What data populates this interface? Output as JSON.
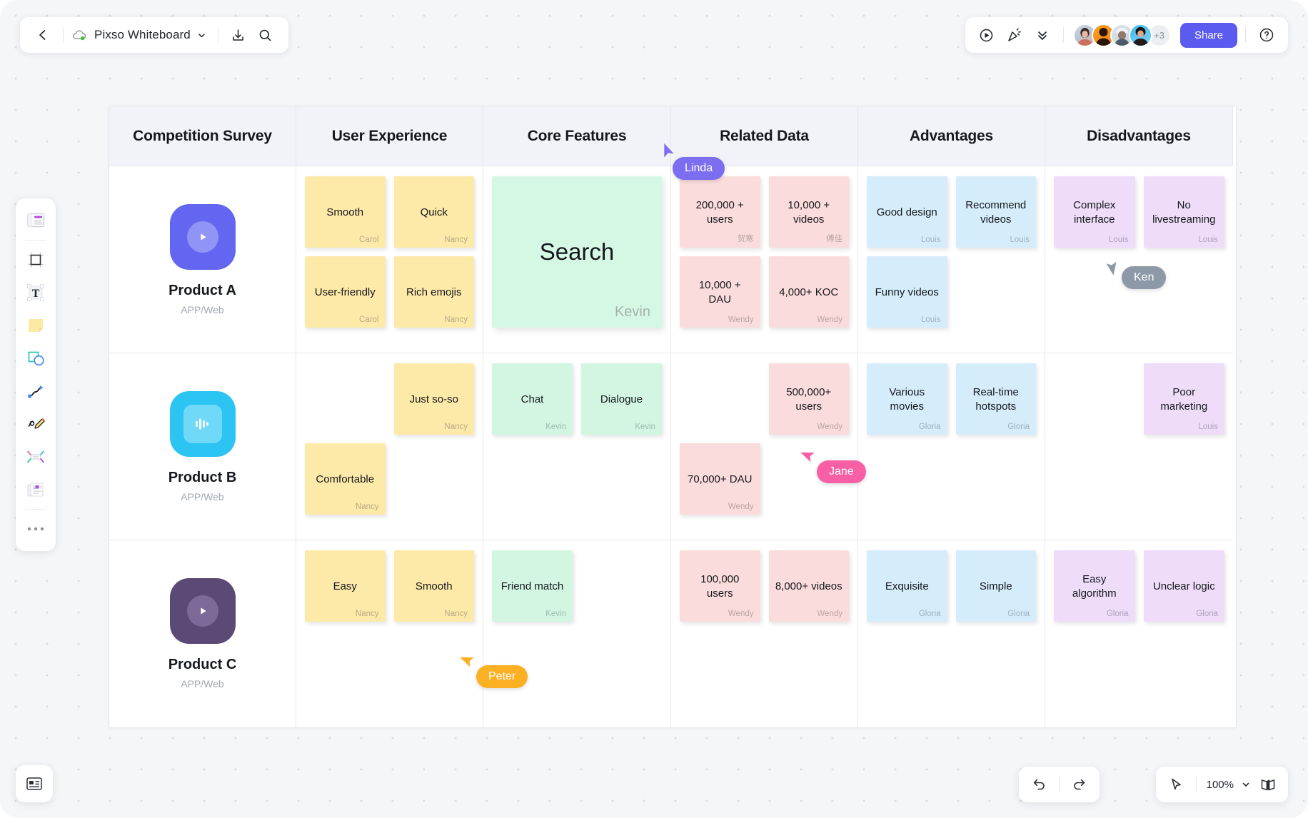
{
  "topbar": {
    "back_icon": "chevron-left-icon",
    "cloud_icon": "cloud-sync-icon",
    "title": "Pixso Whiteboard",
    "title_caret": "chevron-down-icon",
    "export_icon": "download-icon",
    "search_icon": "search-icon"
  },
  "topbar_right": {
    "present_icon": "play-circle-icon",
    "celebrate_icon": "party-popper-icon",
    "collapse_icon": "double-chevron-down-icon",
    "avatars": [
      "user-1",
      "user-2",
      "user-3",
      "user-4"
    ],
    "avatar_overflow": "+3",
    "share_label": "Share",
    "help_icon": "question-circle-icon"
  },
  "left_tools": [
    {
      "name": "frame-template-icon"
    },
    {
      "name": "crop-frame-icon"
    },
    {
      "name": "text-icon"
    },
    {
      "name": "sticky-note-icon"
    },
    {
      "name": "shapes-icon"
    },
    {
      "name": "connector-line-icon"
    },
    {
      "name": "pencil-draw-icon"
    },
    {
      "name": "mindmap-icon"
    },
    {
      "name": "cards-icon"
    },
    {
      "name": "more-options-icon"
    }
  ],
  "bottom_left": {
    "icon": "panel-toggle-icon"
  },
  "bottom_right": {
    "undo_icon": "undo-icon",
    "redo_icon": "redo-icon",
    "cursor_icon": "pointer-cursor-icon",
    "zoom_value": "100%",
    "zoom_caret": "chevron-down-icon",
    "minimap_icon": "minimap-book-icon"
  },
  "board": {
    "headers": [
      "Competition Survey",
      "User Experience",
      "Core Features",
      "Related Data",
      "Advantages",
      "Disadvantages"
    ],
    "rows": [
      {
        "product": {
          "name": "Product A",
          "sub": "APP/Web",
          "icon": "play-app-icon",
          "color": "#6366f1",
          "inner": "#9094f4"
        },
        "user_experience": [
          {
            "text": "Smooth",
            "author": "Carol",
            "color": "yellow"
          },
          {
            "text": "Quick",
            "author": "Nancy",
            "color": "yellow"
          },
          {
            "text": "User-friendly",
            "author": "Carol",
            "color": "yellow"
          },
          {
            "text": "Rich emojis",
            "author": "Nancy",
            "color": "yellow"
          }
        ],
        "core_features_big": {
          "text": "Search",
          "author": "Kevin"
        },
        "core_features": [],
        "related_data": [
          {
            "text": "200,000 + users",
            "author": "贺寒",
            "color": "pink"
          },
          {
            "text": "10,000 + videos",
            "author": "傅佳",
            "color": "pink"
          },
          {
            "text": "10,000 + DAU",
            "author": "Wendy",
            "color": "pink"
          },
          {
            "text": "4,000+ KOC",
            "author": "Wendy",
            "color": "pink"
          }
        ],
        "advantages": [
          {
            "text": "Good design",
            "author": "Louis",
            "color": "blue"
          },
          {
            "text": "Recommend videos",
            "author": "Louis",
            "color": "blue"
          },
          {
            "text": "Funny videos",
            "author": "Louis",
            "color": "blue"
          },
          {
            "text": "",
            "author": "",
            "color": "empty"
          }
        ],
        "disadvantages": [
          {
            "text": "Complex interface",
            "author": "Louis",
            "color": "purple"
          },
          {
            "text": "No livestreaming",
            "author": "Louis",
            "color": "purple"
          }
        ]
      },
      {
        "product": {
          "name": "Product B",
          "sub": "APP/Web",
          "icon": "waveform-app-icon",
          "color": "#2bc4f3",
          "inner": "#6fd9f7"
        },
        "user_experience": [
          {
            "text": "",
            "author": "",
            "color": "empty"
          },
          {
            "text": "Just so-so",
            "author": "Nancy",
            "color": "yellow"
          },
          {
            "text": "Comfortable",
            "author": "Nancy",
            "color": "yellow"
          },
          {
            "text": "",
            "author": "",
            "color": "empty"
          }
        ],
        "core_features": [
          {
            "text": "Chat",
            "author": "Kevin",
            "color": "green"
          },
          {
            "text": "Dialogue",
            "author": "Kevin",
            "color": "green"
          }
        ],
        "related_data": [
          {
            "text": "",
            "author": "",
            "color": "empty"
          },
          {
            "text": "500,000+ users",
            "author": "Wendy",
            "color": "pink"
          },
          {
            "text": "70,000+ DAU",
            "author": "Wendy",
            "color": "pink"
          },
          {
            "text": "",
            "author": "",
            "color": "empty"
          }
        ],
        "advantages": [
          {
            "text": "Various movies",
            "author": "Gloria",
            "color": "blue"
          },
          {
            "text": "Real-time hotspots",
            "author": "Gloria",
            "color": "blue"
          }
        ],
        "disadvantages": [
          {
            "text": "",
            "author": "",
            "color": "empty"
          },
          {
            "text": "Poor marketing",
            "author": "Louis",
            "color": "purple"
          }
        ]
      },
      {
        "product": {
          "name": "Product C",
          "sub": "APP/Web",
          "icon": "play-app-icon",
          "color": "#5b4a75",
          "inner": "#7d6a98"
        },
        "user_experience": [
          {
            "text": "Easy",
            "author": "Nancy",
            "color": "yellow"
          },
          {
            "text": "Smooth",
            "author": "Nancy",
            "color": "yellow"
          }
        ],
        "core_features": [
          {
            "text": "Friend match",
            "author": "Kevin",
            "color": "green"
          },
          {
            "text": "",
            "author": "",
            "color": "empty"
          }
        ],
        "related_data": [
          {
            "text": "100,000 users",
            "author": "Wendy",
            "color": "pink"
          },
          {
            "text": "8,000+ videos",
            "author": "Wendy",
            "color": "pink"
          }
        ],
        "advantages": [
          {
            "text": "Exquisite",
            "author": "Gloria",
            "color": "blue"
          },
          {
            "text": "Simple",
            "author": "Gloria",
            "color": "blue"
          }
        ],
        "disadvantages": [
          {
            "text": "Easy algorithm",
            "author": "Gloria",
            "color": "purple"
          },
          {
            "text": "Unclear logic",
            "author": "Gloria",
            "color": "purple"
          }
        ]
      }
    ]
  },
  "cursors": [
    {
      "name": "Linda",
      "color": "#7c6ef0"
    },
    {
      "name": "Ken",
      "color": "#8d99a6"
    },
    {
      "name": "Jane",
      "color": "#f85fa4"
    },
    {
      "name": "Peter",
      "color": "#fcb023"
    }
  ]
}
